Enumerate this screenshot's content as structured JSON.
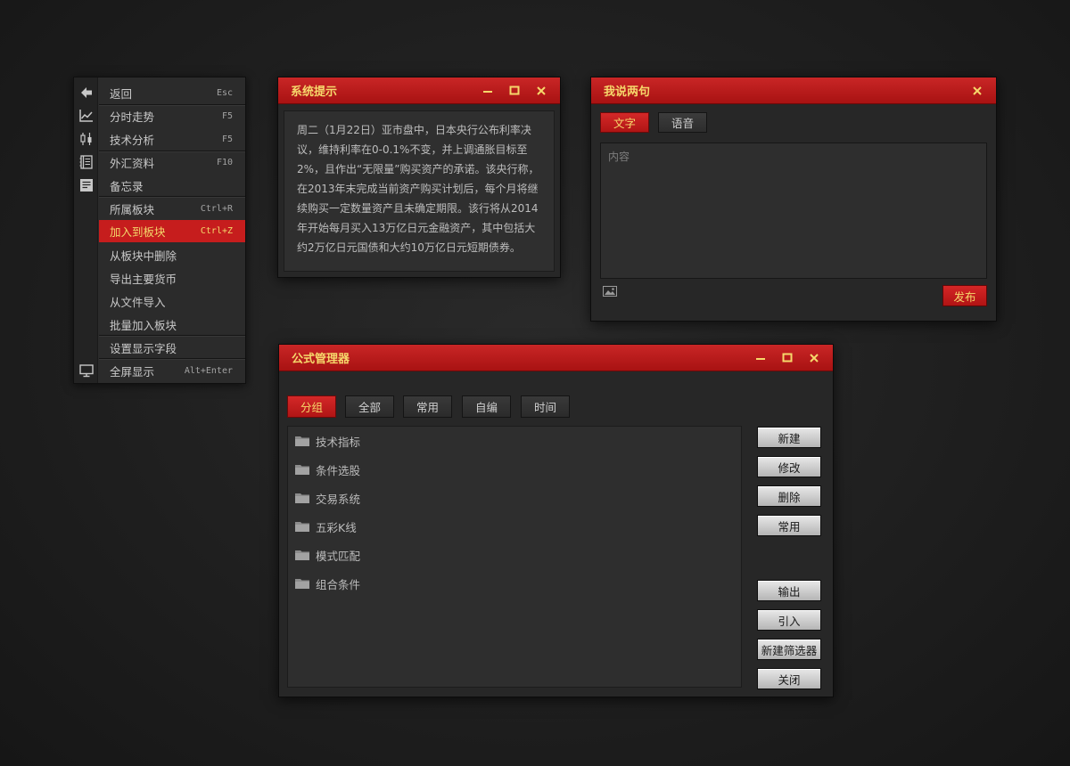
{
  "menu": {
    "items": [
      {
        "label": "返回",
        "shortcut": "Esc"
      },
      {
        "label": "分时走势",
        "shortcut": "F5"
      },
      {
        "label": "技术分析",
        "shortcut": "F5"
      },
      {
        "label": "外汇资料",
        "shortcut": "F10"
      },
      {
        "label": "备忘录",
        "shortcut": ""
      },
      {
        "label": "所属板块",
        "shortcut": "Ctrl+R"
      },
      {
        "label": "加入到板块",
        "shortcut": "Ctrl+Z"
      },
      {
        "label": "从板块中删除",
        "shortcut": ""
      },
      {
        "label": "导出主要货币",
        "shortcut": ""
      },
      {
        "label": "从文件导入",
        "shortcut": ""
      },
      {
        "label": "批量加入板块",
        "shortcut": ""
      },
      {
        "label": "设置显示字段",
        "shortcut": ""
      },
      {
        "label": "全屏显示",
        "shortcut": "Alt+Enter"
      }
    ],
    "active_item": "加入到板块",
    "icons": [
      "back-arrow-icon",
      "line-chart-icon",
      "candlestick-icon",
      "book-icon",
      "memo-icon",
      "monitor-icon"
    ]
  },
  "system_tip": {
    "title": "系统提示",
    "body": "周二（1月22日）亚市盘中，日本央行公布利率决议，维持利率在0-0.1%不变，并上调通胀目标至2%，且作出“无限量”购买资产的承诺。该央行称，在2013年末完成当前资产购买计划后，每个月将继续购买一定数量资产且未确定期限。该行将从2014年开始每月买入13万亿日元金融资产，其中包括大约2万亿日元国债和大约10万亿日元短期债券。"
  },
  "quick_post": {
    "title": "我说两句",
    "tabs": [
      "文字",
      "语音"
    ],
    "active_tab": "文字",
    "content_placeholder": "内容",
    "publish_label": "发布"
  },
  "formula_manager": {
    "title": "公式管理器",
    "tabs": [
      "分组",
      "全部",
      "常用",
      "自编",
      "时间"
    ],
    "active_tab": "分组",
    "folders": [
      "技术指标",
      "条件选股",
      "交易系统",
      "五彩K线",
      "模式匹配",
      "组合条件"
    ],
    "buttons": [
      "新建",
      "修改",
      "删除",
      "常用",
      "输出",
      "引入",
      "新建筛选器",
      "关闭"
    ]
  },
  "colors": {
    "title_bar": "#b81a1a",
    "title_text": "#f6d86b",
    "menu_highlight": "#c61d1d",
    "background": "#222222"
  }
}
